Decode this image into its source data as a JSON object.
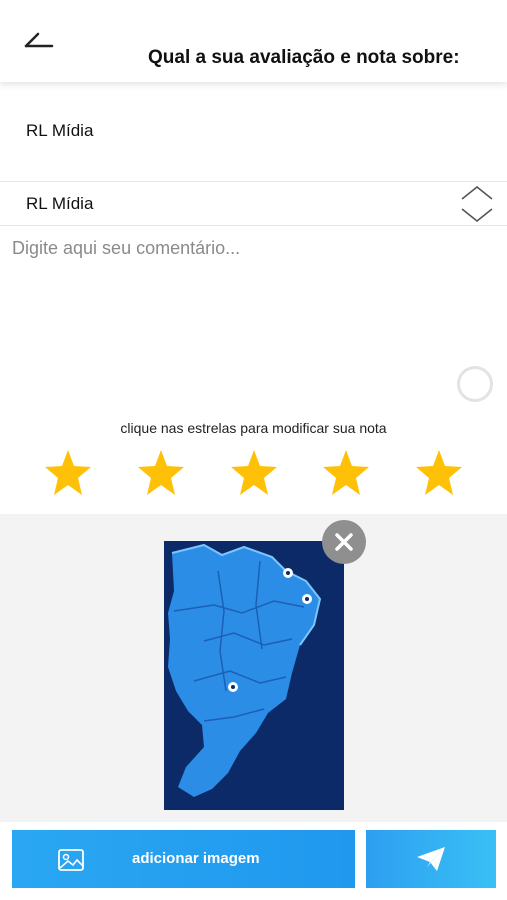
{
  "header": {
    "back_icon": "back-arrow-icon",
    "title": "Qual a sua avaliação e nota sobre:"
  },
  "review_target": {
    "name": "RL Mídia"
  },
  "selector": {
    "value": "RL Mídia",
    "icon": "up-down-chevron-icon"
  },
  "comment": {
    "value": "",
    "placeholder": "Digite aqui seu comentário..."
  },
  "rating": {
    "hint": "clique nas estrelas para modificar sua nota",
    "value": 5,
    "max": 5,
    "star_color": "#ffc107"
  },
  "attachments": {
    "items": [
      {
        "description_icon": "brazil-map-image",
        "remove_icon": "close-icon"
      }
    ]
  },
  "actions": {
    "add_image_label": "adicionar imagem",
    "add_image_icon": "image-icon",
    "send_icon": "paper-plane-icon",
    "primary_color": "#2aa7f2"
  }
}
